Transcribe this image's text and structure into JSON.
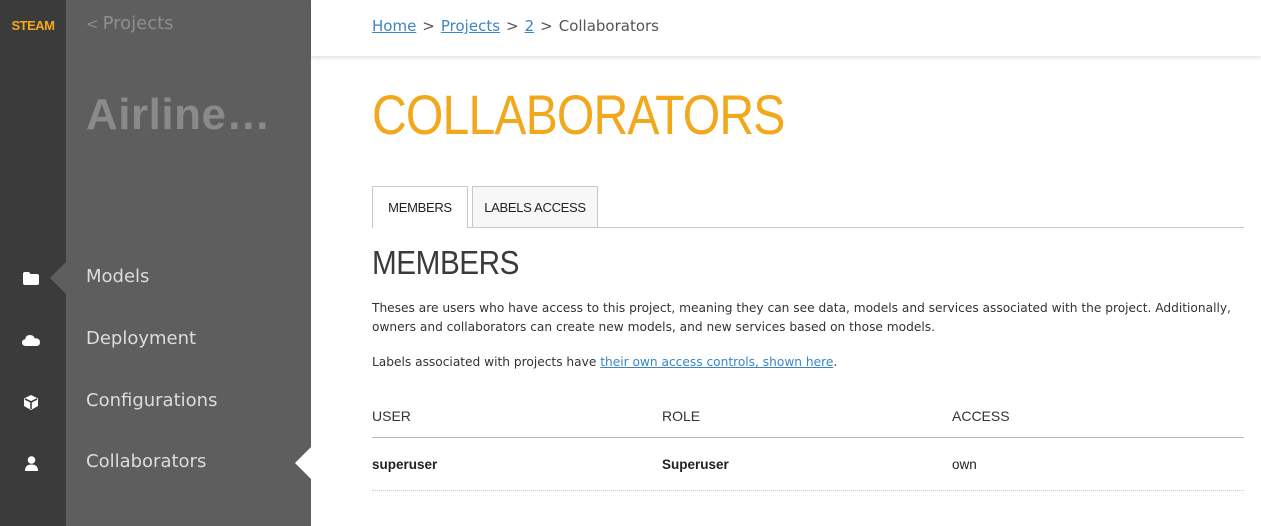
{
  "brand": "STEAM",
  "sidebar": {
    "back_label": "Projects",
    "project_name": "AirlineDa...",
    "items": [
      {
        "label": "Models",
        "icon": "folder-icon"
      },
      {
        "label": "Deployment",
        "icon": "cloud-icon"
      },
      {
        "label": "Configurations",
        "icon": "cube-icon"
      },
      {
        "label": "Collaborators",
        "icon": "user-icon"
      }
    ]
  },
  "breadcrumb": {
    "home": "Home",
    "projects": "Projects",
    "project_id": "2",
    "current": "Collaborators",
    "separator": ">"
  },
  "page_title": "COLLABORATORS",
  "tabs": [
    {
      "label": "MEMBERS",
      "active": true
    },
    {
      "label": "LABELS ACCESS",
      "active": false
    }
  ],
  "section_title": "MEMBERS",
  "description": "Theses are users who have access to this project, meaning they can see data, models and services associated with the project. Additionally, owners and collaborators can create new models, and new services based on those models.",
  "labels_note": {
    "prefix": "Labels associated with projects have ",
    "link": "their own access controls, shown here",
    "suffix": "."
  },
  "table": {
    "headers": [
      "USER",
      "ROLE",
      "ACCESS"
    ],
    "rows": [
      [
        "superuser",
        "Superuser",
        "own"
      ]
    ]
  },
  "colors": {
    "accent": "#f2a81d",
    "link": "#3a86c6",
    "rail": "#3b3b3b",
    "sidebar": "#5e5e5e"
  }
}
